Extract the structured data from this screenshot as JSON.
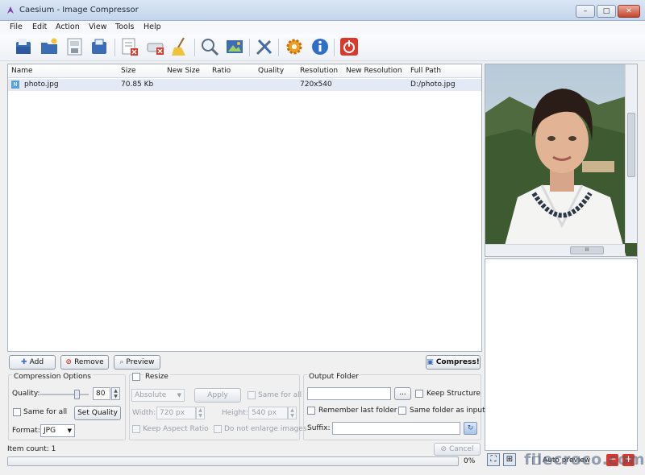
{
  "window": {
    "title": "Caesium - Image Compressor",
    "min": "–",
    "max": "□",
    "close": "✕"
  },
  "menu": [
    "File",
    "Edit",
    "Action",
    "View",
    "Tools",
    "Help"
  ],
  "table": {
    "columns": [
      "Name",
      "Size",
      "New Size",
      "Ratio",
      "Quality",
      "Resolution",
      "New Resolution",
      "Full Path"
    ],
    "rows": [
      {
        "name": "photo.jpg",
        "size": "70.85 Kb",
        "new_size": "",
        "ratio": "",
        "quality": "",
        "resolution": "720x540",
        "new_resolution": "",
        "full_path": "D:/photo.jpg"
      }
    ]
  },
  "preview": {
    "scroll_thumb": "III"
  },
  "actions": {
    "add": "Add",
    "remove": "Remove",
    "preview": "Preview",
    "compress": "Compress!"
  },
  "compression": {
    "title": "Compression Options",
    "quality_label": "Quality:",
    "quality_value": "80",
    "quality_level": 0.8,
    "same_for_all": "Same for all",
    "set_quality": "Set Quality",
    "format_label": "Format:",
    "format_value": "JPG"
  },
  "resize": {
    "title": "Resize",
    "mode": "Absolute",
    "apply": "Apply",
    "same_for_all": "Same for all",
    "width_label": "Width:",
    "width_value": "720 px",
    "height_label": "Height:",
    "height_value": "540 px",
    "keep_aspect": "Keep Aspect Ratio",
    "no_enlarge": "Do not enlarge images"
  },
  "output": {
    "title": "Output Folder",
    "browse": "...",
    "keep_structure": "Keep Structure",
    "remember_last": "Remember last folder",
    "same_folder": "Same folder as input",
    "suffix_label": "Suffix:"
  },
  "status": {
    "item_count": "Item count: 1",
    "cancel": "Cancel",
    "progress_text": "0%",
    "progress": 0
  },
  "footer": {
    "auto_preview": "Auto preview",
    "watermark": "filecroco.com"
  },
  "colors": {
    "accent": "#3d6fb8",
    "danger": "#d9382b",
    "selection": "#e3eaf5"
  }
}
